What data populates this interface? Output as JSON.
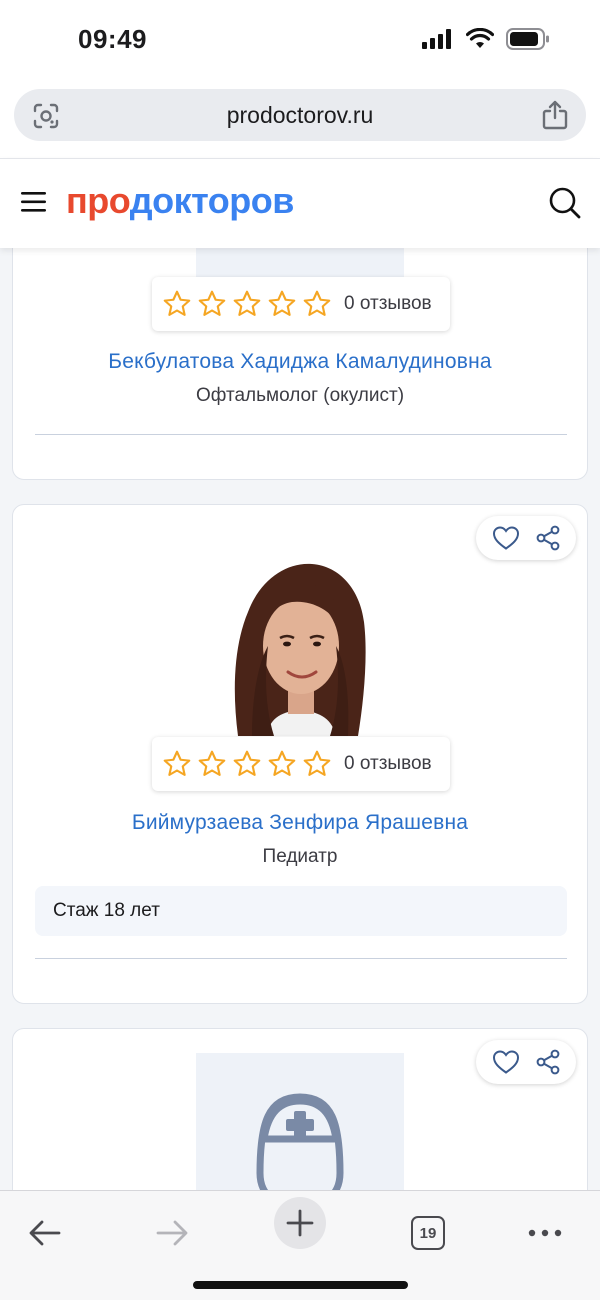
{
  "status_bar": {
    "time": "09:49",
    "icons": [
      "cellular-signal-icon",
      "wifi-icon",
      "battery-icon"
    ]
  },
  "browser": {
    "url": "prodoctorov.ru",
    "tab_count": "19"
  },
  "site": {
    "logo_part1": "про",
    "logo_part2": "докторов",
    "colors": {
      "logo_red": "#e8492e",
      "logo_blue": "#3a82f0",
      "link_blue": "#2a6fc9",
      "star_orange": "#f5a623"
    }
  },
  "doctors": [
    {
      "name": "Бекбулатова Хадиджа Камалудиновна",
      "specialty": "Офтальмолог (окулист)",
      "rating_stars": 0,
      "reviews": "0 отзывов"
    },
    {
      "name": "Биймурзаева Зенфира Ярашевна",
      "specialty": "Педиатр",
      "rating_stars": 0,
      "reviews": "0 отзывов",
      "experience": "Стаж 18 лет"
    },
    {
      "photo": "doctor-placeholder-icon"
    }
  ]
}
